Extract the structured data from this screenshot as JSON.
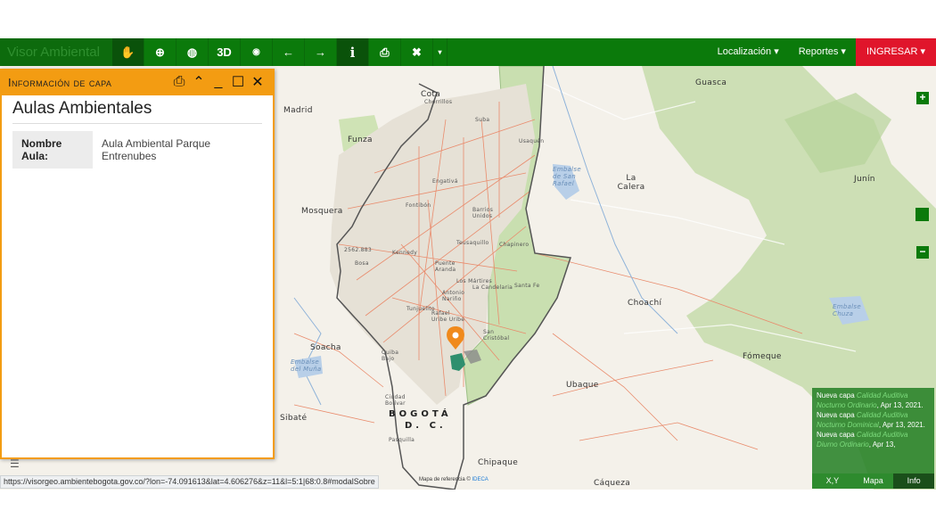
{
  "toolbar": {
    "brand": "Visor Ambiental",
    "buttons": [
      {
        "name": "pan-tool-button",
        "icon": "hand-icon",
        "glyph": "✋"
      },
      {
        "name": "zoom-tool-button",
        "icon": "zoom-icon",
        "glyph": "⊕"
      },
      {
        "name": "globe-button",
        "icon": "globe-icon",
        "glyph": "⊕"
      },
      {
        "name": "3d-button",
        "label": "3D"
      },
      {
        "name": "identify-button",
        "icon": "target-icon",
        "glyph": "◉"
      },
      {
        "name": "back-button",
        "icon": "arrow-left-icon",
        "glyph": "←"
      },
      {
        "name": "forward-button",
        "icon": "arrow-right-icon",
        "glyph": "→"
      },
      {
        "name": "info-button",
        "icon": "info-icon",
        "glyph": "i"
      },
      {
        "name": "print-button",
        "icon": "print-icon",
        "glyph": "⎙"
      },
      {
        "name": "tools-button",
        "icon": "tools-icon",
        "glyph": "✖"
      }
    ],
    "three_d_label": "3D",
    "menu_localizacion": "Localización ▾",
    "menu_reportes": "Reportes ▾",
    "login_label": "INGRESAR ▾",
    "colors": {
      "bar": "#0b7a0b",
      "login": "#e0152b"
    }
  },
  "info_panel": {
    "title": "Información de capa",
    "layer_name": "Aulas Ambientales",
    "attributes": [
      {
        "key": "Nombre Aula:",
        "value": "Aula Ambiental Parque Entrenubes"
      }
    ],
    "accent": "#f39c12"
  },
  "map": {
    "places": {
      "cota": "Cota",
      "chorrillos": "Chorrillos",
      "suba": "Suba",
      "usaquen": "Usaquén",
      "funza": "Funza",
      "madrid": "Madrid",
      "mosquera": "Mosquera",
      "engativa": "Engativá",
      "fontibon": "Fontibón",
      "barrios_unidos": "Barrios Unidos",
      "teusaquillo": "Teusaquillo",
      "chapinero": "Chapinero",
      "kennedy": "Kennedy",
      "bosa": "Bosa",
      "puente_aranda": "Puente Aranda",
      "martires": "Los Mártires",
      "candelaria": "La Candelaria",
      "santa_fe": "Santa Fe",
      "antonio_narino": "Antonio Nariño",
      "tunjuelito": "Tunjuelito",
      "rafael_uribe": "Rafael Uribe Uribe",
      "san_cristobal": "San Cristóbal",
      "soacha": "Soacha",
      "quiba_bajo": "Quiba Bajo",
      "embalse_muna": "Embalse del Muña",
      "ciudad_bolivar": "Ciudad Bolívar",
      "sibate": "Sibaté",
      "pasquilla": "Pasquilla",
      "bogota": "BOGOTÁ",
      "dc": "D. C.",
      "la_calera": "La Calera",
      "embalse_san_rafael": "Embalse de San Rafael",
      "guasca": "Guasca",
      "junin": "Junín",
      "choachi": "Choachí",
      "ubaque": "Ubaque",
      "fomeque": "Fómeque",
      "chipaque": "Chipaque",
      "caqueza": "Cáqueza",
      "embalse_chuza": "Embalse Chuza",
      "elev": "2562.883"
    },
    "zoom_in": "+",
    "zoom_out": "−"
  },
  "notifications": {
    "items": [
      {
        "prefix": "Nueva capa ",
        "layer": "Calidad Auditiva Nocturno Ordinario",
        "date": ", Apr 13, 2021."
      },
      {
        "prefix": "Nueva capa ",
        "layer": "Calidad Auditiva Nocturno Dominical",
        "date": ", Apr 13, 2021."
      },
      {
        "prefix": "Nueva capa ",
        "layer": "Calidad Auditiva Diurno Ordinario",
        "date": ", Apr 13,"
      }
    ],
    "tabs": [
      "X,Y",
      "Mapa",
      "Info"
    ]
  },
  "status": {
    "url": "https://visorgeo.ambientebogota.gov.co/?lon=-74.091613&lat=4.606276&z=11&l=5:1|68:0.8#modalSobre",
    "attribution_prefix": "Mapa de referencia © ",
    "attribution_link": "IDECA"
  }
}
